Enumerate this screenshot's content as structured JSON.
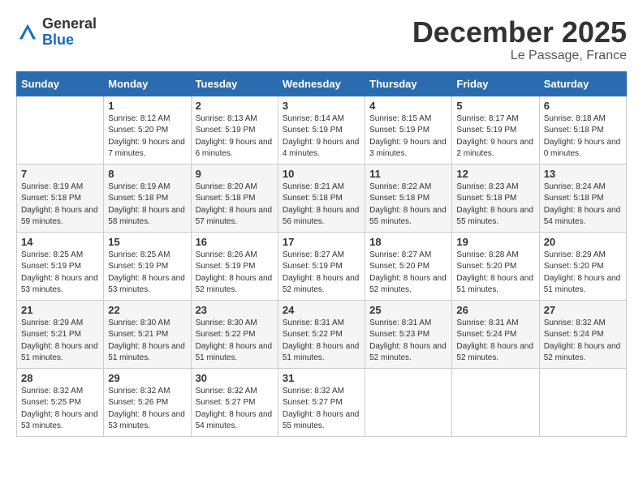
{
  "logo": {
    "general": "General",
    "blue": "Blue"
  },
  "title": "December 2025",
  "location": "Le Passage, France",
  "days_header": [
    "Sunday",
    "Monday",
    "Tuesday",
    "Wednesday",
    "Thursday",
    "Friday",
    "Saturday"
  ],
  "weeks": [
    [
      {
        "day": "",
        "sunrise": "",
        "sunset": "",
        "daylight": ""
      },
      {
        "day": "1",
        "sunrise": "Sunrise: 8:12 AM",
        "sunset": "Sunset: 5:20 PM",
        "daylight": "Daylight: 9 hours and 7 minutes."
      },
      {
        "day": "2",
        "sunrise": "Sunrise: 8:13 AM",
        "sunset": "Sunset: 5:19 PM",
        "daylight": "Daylight: 9 hours and 6 minutes."
      },
      {
        "day": "3",
        "sunrise": "Sunrise: 8:14 AM",
        "sunset": "Sunset: 5:19 PM",
        "daylight": "Daylight: 9 hours and 4 minutes."
      },
      {
        "day": "4",
        "sunrise": "Sunrise: 8:15 AM",
        "sunset": "Sunset: 5:19 PM",
        "daylight": "Daylight: 9 hours and 3 minutes."
      },
      {
        "day": "5",
        "sunrise": "Sunrise: 8:17 AM",
        "sunset": "Sunset: 5:19 PM",
        "daylight": "Daylight: 9 hours and 2 minutes."
      },
      {
        "day": "6",
        "sunrise": "Sunrise: 8:18 AM",
        "sunset": "Sunset: 5:18 PM",
        "daylight": "Daylight: 9 hours and 0 minutes."
      }
    ],
    [
      {
        "day": "7",
        "sunrise": "Sunrise: 8:19 AM",
        "sunset": "Sunset: 5:18 PM",
        "daylight": "Daylight: 8 hours and 59 minutes."
      },
      {
        "day": "8",
        "sunrise": "Sunrise: 8:19 AM",
        "sunset": "Sunset: 5:18 PM",
        "daylight": "Daylight: 8 hours and 58 minutes."
      },
      {
        "day": "9",
        "sunrise": "Sunrise: 8:20 AM",
        "sunset": "Sunset: 5:18 PM",
        "daylight": "Daylight: 8 hours and 57 minutes."
      },
      {
        "day": "10",
        "sunrise": "Sunrise: 8:21 AM",
        "sunset": "Sunset: 5:18 PM",
        "daylight": "Daylight: 8 hours and 56 minutes."
      },
      {
        "day": "11",
        "sunrise": "Sunrise: 8:22 AM",
        "sunset": "Sunset: 5:18 PM",
        "daylight": "Daylight: 8 hours and 55 minutes."
      },
      {
        "day": "12",
        "sunrise": "Sunrise: 8:23 AM",
        "sunset": "Sunset: 5:18 PM",
        "daylight": "Daylight: 8 hours and 55 minutes."
      },
      {
        "day": "13",
        "sunrise": "Sunrise: 8:24 AM",
        "sunset": "Sunset: 5:18 PM",
        "daylight": "Daylight: 8 hours and 54 minutes."
      }
    ],
    [
      {
        "day": "14",
        "sunrise": "Sunrise: 8:25 AM",
        "sunset": "Sunset: 5:19 PM",
        "daylight": "Daylight: 8 hours and 53 minutes."
      },
      {
        "day": "15",
        "sunrise": "Sunrise: 8:25 AM",
        "sunset": "Sunset: 5:19 PM",
        "daylight": "Daylight: 8 hours and 53 minutes."
      },
      {
        "day": "16",
        "sunrise": "Sunrise: 8:26 AM",
        "sunset": "Sunset: 5:19 PM",
        "daylight": "Daylight: 8 hours and 52 minutes."
      },
      {
        "day": "17",
        "sunrise": "Sunrise: 8:27 AM",
        "sunset": "Sunset: 5:19 PM",
        "daylight": "Daylight: 8 hours and 52 minutes."
      },
      {
        "day": "18",
        "sunrise": "Sunrise: 8:27 AM",
        "sunset": "Sunset: 5:20 PM",
        "daylight": "Daylight: 8 hours and 52 minutes."
      },
      {
        "day": "19",
        "sunrise": "Sunrise: 8:28 AM",
        "sunset": "Sunset: 5:20 PM",
        "daylight": "Daylight: 8 hours and 51 minutes."
      },
      {
        "day": "20",
        "sunrise": "Sunrise: 8:29 AM",
        "sunset": "Sunset: 5:20 PM",
        "daylight": "Daylight: 8 hours and 51 minutes."
      }
    ],
    [
      {
        "day": "21",
        "sunrise": "Sunrise: 8:29 AM",
        "sunset": "Sunset: 5:21 PM",
        "daylight": "Daylight: 8 hours and 51 minutes."
      },
      {
        "day": "22",
        "sunrise": "Sunrise: 8:30 AM",
        "sunset": "Sunset: 5:21 PM",
        "daylight": "Daylight: 8 hours and 51 minutes."
      },
      {
        "day": "23",
        "sunrise": "Sunrise: 8:30 AM",
        "sunset": "Sunset: 5:22 PM",
        "daylight": "Daylight: 8 hours and 51 minutes."
      },
      {
        "day": "24",
        "sunrise": "Sunrise: 8:31 AM",
        "sunset": "Sunset: 5:22 PM",
        "daylight": "Daylight: 8 hours and 51 minutes."
      },
      {
        "day": "25",
        "sunrise": "Sunrise: 8:31 AM",
        "sunset": "Sunset: 5:23 PM",
        "daylight": "Daylight: 8 hours and 52 minutes."
      },
      {
        "day": "26",
        "sunrise": "Sunrise: 8:31 AM",
        "sunset": "Sunset: 5:24 PM",
        "daylight": "Daylight: 8 hours and 52 minutes."
      },
      {
        "day": "27",
        "sunrise": "Sunrise: 8:32 AM",
        "sunset": "Sunset: 5:24 PM",
        "daylight": "Daylight: 8 hours and 52 minutes."
      }
    ],
    [
      {
        "day": "28",
        "sunrise": "Sunrise: 8:32 AM",
        "sunset": "Sunset: 5:25 PM",
        "daylight": "Daylight: 8 hours and 53 minutes."
      },
      {
        "day": "29",
        "sunrise": "Sunrise: 8:32 AM",
        "sunset": "Sunset: 5:26 PM",
        "daylight": "Daylight: 8 hours and 53 minutes."
      },
      {
        "day": "30",
        "sunrise": "Sunrise: 8:32 AM",
        "sunset": "Sunset: 5:27 PM",
        "daylight": "Daylight: 8 hours and 54 minutes."
      },
      {
        "day": "31",
        "sunrise": "Sunrise: 8:32 AM",
        "sunset": "Sunset: 5:27 PM",
        "daylight": "Daylight: 8 hours and 55 minutes."
      },
      {
        "day": "",
        "sunrise": "",
        "sunset": "",
        "daylight": ""
      },
      {
        "day": "",
        "sunrise": "",
        "sunset": "",
        "daylight": ""
      },
      {
        "day": "",
        "sunrise": "",
        "sunset": "",
        "daylight": ""
      }
    ]
  ]
}
